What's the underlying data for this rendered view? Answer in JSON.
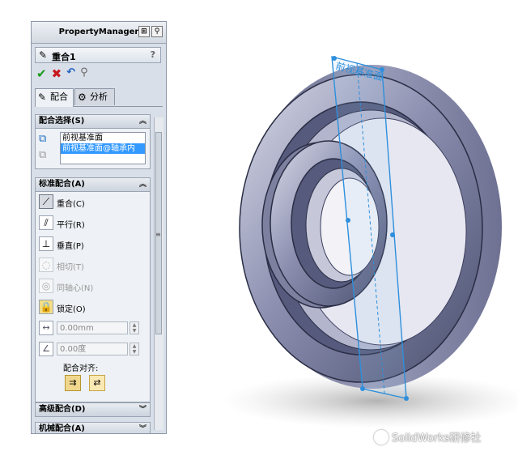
{
  "property_manager": {
    "title": "PropertyManager",
    "feature_name": "重合1",
    "help_glyph": "?",
    "tabs": [
      {
        "label": "配合",
        "active": true
      },
      {
        "label": "分析",
        "active": false
      }
    ],
    "mate_selection": {
      "header": "配合选择(S)",
      "items": [
        "前视基准面",
        "前视基准面@轴承内"
      ]
    },
    "standard_mates": {
      "header": "标准配合(A)",
      "items": [
        {
          "label": "重合(C)",
          "enabled": true,
          "selected": true
        },
        {
          "label": "平行(R)",
          "enabled": true,
          "selected": false
        },
        {
          "label": "垂直(P)",
          "enabled": true,
          "selected": false
        },
        {
          "label": "相切(T)",
          "enabled": false,
          "selected": false
        },
        {
          "label": "同轴心(N)",
          "enabled": false,
          "selected": false
        },
        {
          "label": "锁定(O)",
          "enabled": true,
          "selected": false
        }
      ],
      "distance_value": "0.00mm",
      "angle_value": "0.00度",
      "alignment_label": "配合对齐:"
    },
    "advanced_mates": {
      "header": "高级配合(D)"
    },
    "mechanical_mates": {
      "header": "机械配合(A)"
    }
  },
  "viewport": {
    "plane_label": "前视基准面",
    "watermark": "SolidWorks研修社"
  },
  "colors": {
    "panel_bg": "#d9dfe8",
    "selection_highlight": "#3399ff",
    "plane_edge": "#2e8fdc",
    "model_body": "#4a4f6e"
  }
}
